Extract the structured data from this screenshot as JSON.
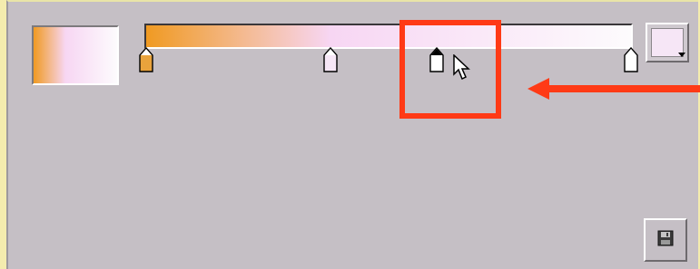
{
  "colors": {
    "gradient_start": "#f09a22",
    "gradient_mid": "#f7d6f3",
    "gradient_end": "#fdfbfd",
    "panel": "#c5bfc5",
    "highlight": "#ff3a16",
    "picker_swatch": "#f6e6f6"
  },
  "gradient_editor": {
    "stops": [
      {
        "position": 0.0,
        "color": "#e9a33c",
        "selected": false
      },
      {
        "position": 0.38,
        "color": "#f7e7f7",
        "selected": false
      },
      {
        "position": 0.6,
        "color": "#ffffff",
        "selected": true
      },
      {
        "position": 1.0,
        "color": "#ffffff",
        "selected": false
      }
    ]
  },
  "icons": {
    "save": "save-icon",
    "cursor": "mouse-pointer-icon",
    "arrow": "arrow-left-icon",
    "dropdown": "chevron-down-icon"
  }
}
